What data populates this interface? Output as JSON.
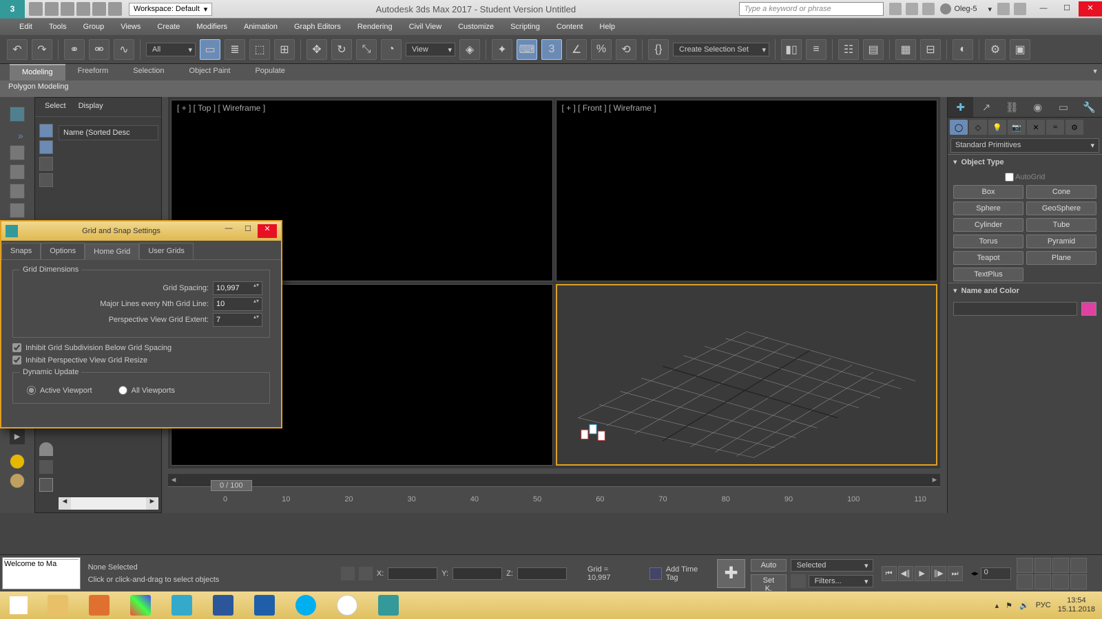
{
  "titlebar": {
    "workspace_label": "Workspace: Default",
    "app_title": "Autodesk 3ds Max 2017 - Student Version   Untitled",
    "search_placeholder": "Type a keyword or phrase",
    "user": "Oleg-5"
  },
  "menubar": [
    "Edit",
    "Tools",
    "Group",
    "Views",
    "Create",
    "Modifiers",
    "Animation",
    "Graph Editors",
    "Rendering",
    "Civil View",
    "Customize",
    "Scripting",
    "Content",
    "Help"
  ],
  "maintool": {
    "filter_dd": "All",
    "view_dd": "View",
    "selset_dd": "Create Selection Set"
  },
  "ribbon": {
    "tabs": [
      "Modeling",
      "Freeform",
      "Selection",
      "Object Paint",
      "Populate"
    ],
    "sub": "Polygon Modeling"
  },
  "scene_explorer": {
    "tabs": [
      "Select",
      "Display"
    ],
    "header": "Name (Sorted Desc"
  },
  "viewports": {
    "v0": "[ + ]  [ Top ]  [ Wireframe ]",
    "v1": "[ + ]  [ Front ]  [ Wireframe ]",
    "v2": "",
    "v3": ""
  },
  "timeline": {
    "thumb": "0 / 100",
    "ticks": [
      "0",
      "10",
      "20",
      "30",
      "40",
      "50",
      "60",
      "70",
      "80",
      "90",
      "100",
      "110"
    ]
  },
  "cmd": {
    "category": "Standard Primitives",
    "r_objtype": "Object Type",
    "autogrid": "AutoGrid",
    "prims": [
      "Box",
      "Cone",
      "Sphere",
      "GeoSphere",
      "Cylinder",
      "Tube",
      "Torus",
      "Pyramid",
      "Teapot",
      "Plane",
      "TextPlus"
    ],
    "r_namecolor": "Name and Color"
  },
  "status": {
    "mini0": " ",
    "mini1": "Welcome to Ma",
    "sel": "None Selected",
    "prompt": "Click or click-and-drag to select objects",
    "xl": "X:",
    "yl": "Y:",
    "zl": "Z:",
    "grid": "Grid = 10,997",
    "addtag": "Add Time Tag",
    "auto": "Auto",
    "setk": "Set K.",
    "selected": "Selected",
    "filters": "Filters...",
    "frame": "0"
  },
  "dialog": {
    "title": "Grid and Snap Settings",
    "tabs": [
      "Snaps",
      "Options",
      "Home Grid",
      "User Grids"
    ],
    "grp_dim": "Grid Dimensions",
    "l_spacing": "Grid Spacing:",
    "v_spacing": "10,997",
    "l_major": "Major Lines every Nth Grid Line:",
    "v_major": "10",
    "l_extent": "Perspective View Grid Extent:",
    "v_extent": "7",
    "chk1": "Inhibit Grid Subdivision Below Grid Spacing",
    "chk2": "Inhibit Perspective View Grid Resize",
    "grp_dyn": "Dynamic Update",
    "r1": "Active Viewport",
    "r2": "All Viewports"
  },
  "taskbar": {
    "lang": "РУС",
    "time": "13:54",
    "date": "15.11.2018"
  }
}
